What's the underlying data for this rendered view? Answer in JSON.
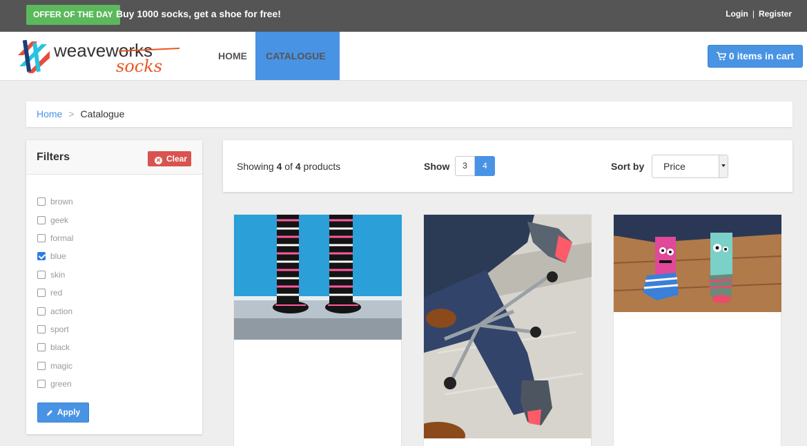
{
  "topbar": {
    "offer_badge": "OFFER OF THE DAY",
    "offer_text": "Buy 1000 socks, get a shoe for free!",
    "login": "Login",
    "separator": "|",
    "register": "Register"
  },
  "nav": {
    "logo_top": "weaveworks",
    "logo_bottom": "socks",
    "home": "HOME",
    "catalogue": "CATALOGUE",
    "cart": "0 items in cart"
  },
  "breadcrumb": {
    "home": "Home",
    "separator": ">",
    "current": "Catalogue"
  },
  "filters": {
    "title": "Filters",
    "clear": "Clear",
    "apply": "Apply",
    "tags": [
      {
        "label": "brown",
        "checked": false
      },
      {
        "label": "geek",
        "checked": false
      },
      {
        "label": "formal",
        "checked": false
      },
      {
        "label": "blue",
        "checked": true
      },
      {
        "label": "skin",
        "checked": false
      },
      {
        "label": "red",
        "checked": false
      },
      {
        "label": "action",
        "checked": false
      },
      {
        "label": "sport",
        "checked": false
      },
      {
        "label": "black",
        "checked": false
      },
      {
        "label": "magic",
        "checked": false
      },
      {
        "label": "green",
        "checked": false
      }
    ]
  },
  "toolbar": {
    "showing_prefix": "Showing",
    "showing_count": "4",
    "showing_of": "of",
    "showing_total": "4",
    "showing_suffix": "products",
    "show_label": "Show",
    "show_options": [
      "3",
      "4"
    ],
    "show_selected": "4",
    "sort_label": "Sort by",
    "sort_value": "Price"
  },
  "colors": {
    "accent": "#4993e4",
    "offer_green": "#5cb85c",
    "clear_red": "#d9534f",
    "topbar": "#555555"
  }
}
